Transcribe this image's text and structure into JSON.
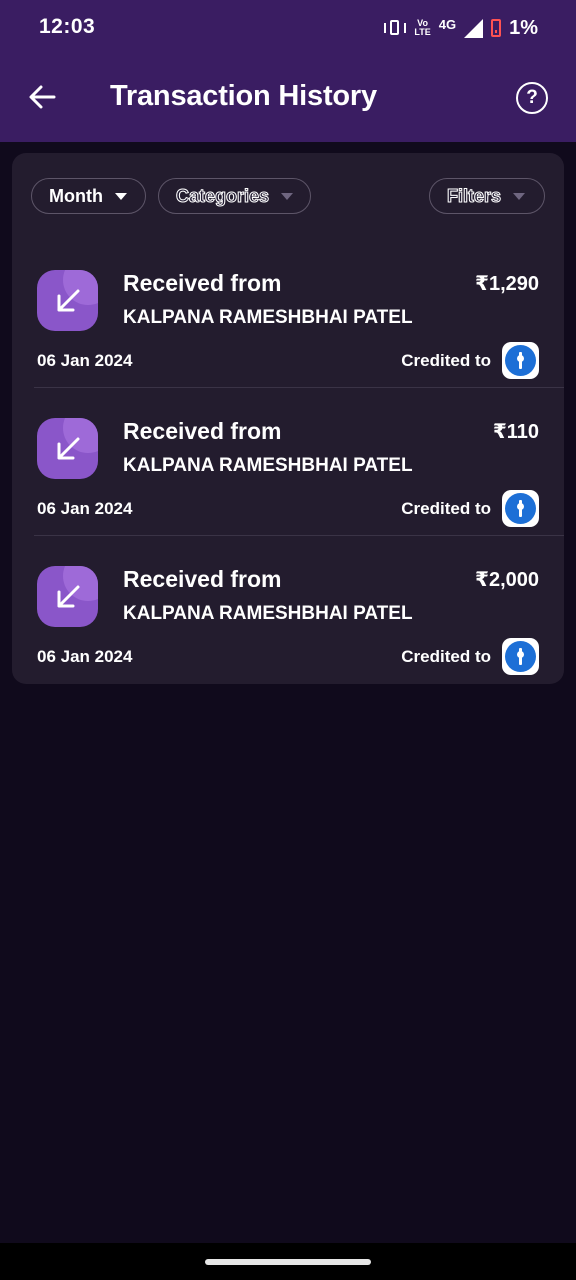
{
  "status_bar": {
    "time": "12:03",
    "network_type": "4G",
    "volte_line1": "Vo",
    "volte_line2": "LTE",
    "battery": "1%",
    "icons": [
      "vibrate-icon",
      "volte-icon",
      "signal-icon",
      "battery-icon"
    ]
  },
  "header": {
    "title": "Transaction History",
    "back_icon": "arrow-left-icon",
    "help_icon": "help-circle-icon",
    "help_glyph": "?"
  },
  "filters": [
    {
      "label": "Month",
      "icon": "caret-down-icon"
    },
    {
      "label": "Categories",
      "icon": "caret-down-icon"
    },
    {
      "label": "Filters",
      "icon": "caret-down-icon"
    }
  ],
  "transactions": [
    {
      "title": "Received from",
      "name": "KALPANA RAMESHBHAI PATEL",
      "amount": "₹1,290",
      "date": "06 Jan 2024",
      "status": "Credited to",
      "icon": "arrow-down-left-icon",
      "bank_icon": "sbi-bank-icon"
    },
    {
      "title": "Received from",
      "name": "KALPANA RAMESHBHAI PATEL",
      "amount": "₹110",
      "date": "06 Jan 2024",
      "status": "Credited to",
      "icon": "arrow-down-left-icon",
      "bank_icon": "sbi-bank-icon"
    },
    {
      "title": "Received from",
      "name": "KALPANA RAMESHBHAI PATEL",
      "amount": "₹2,000",
      "date": "06 Jan 2024",
      "status": "Credited to",
      "icon": "arrow-down-left-icon",
      "bank_icon": "sbi-bank-icon"
    }
  ],
  "colors": {
    "header_bg": "#3a1d62",
    "page_bg": "#100a1c",
    "card_bg": "#231c2e",
    "icon_bg": "#8a56c9",
    "bank_blue": "#1d6fd6"
  }
}
